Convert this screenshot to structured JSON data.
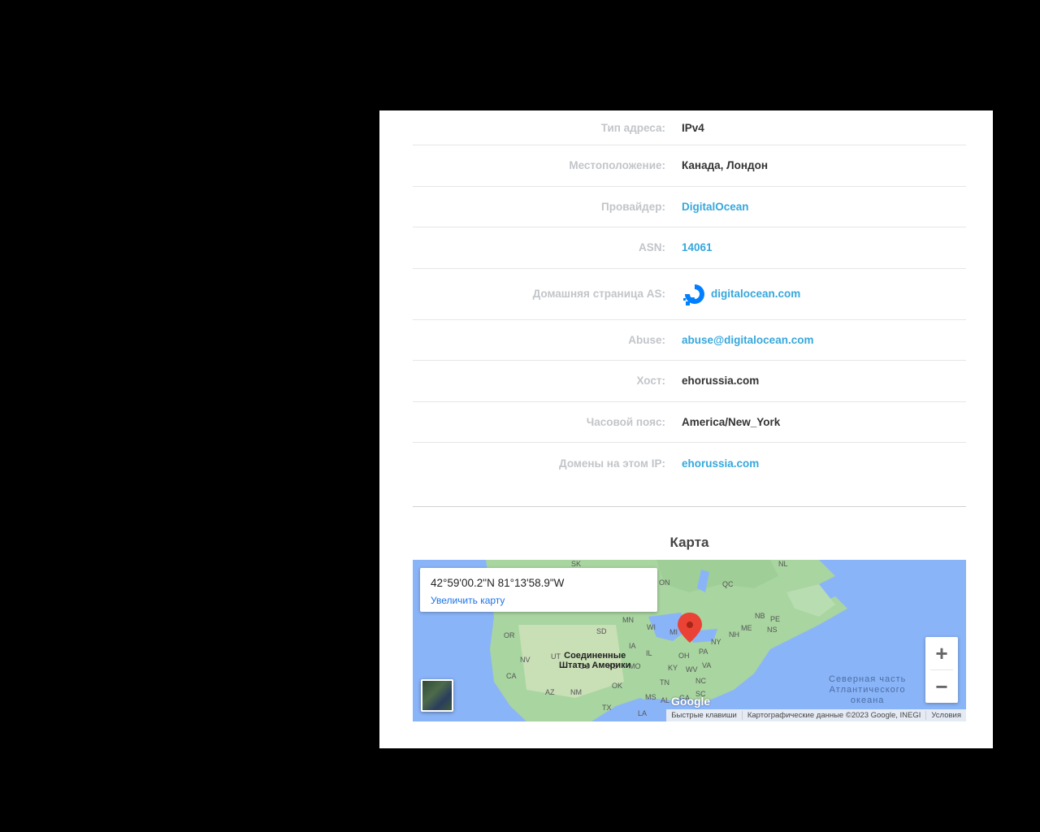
{
  "rows": [
    {
      "label": "Тип адреса:",
      "value": "IPv4",
      "link": false
    },
    {
      "label": "Местоположение:",
      "value": "Канада, Лондон",
      "link": false
    },
    {
      "label": "Провайдер:",
      "value": "DigitalOcean",
      "link": true
    },
    {
      "label": "ASN:",
      "value": "14061",
      "link": true
    },
    {
      "label": "Домашняя страница AS:",
      "value": "digitalocean.com",
      "link": true
    },
    {
      "label": "Abuse:",
      "value": "abuse@digitalocean.com",
      "link": true
    },
    {
      "label": "Хост:",
      "value": "ehorussia.com",
      "link": false
    },
    {
      "label": "Часовой пояс:",
      "value": "America/New_York",
      "link": false
    },
    {
      "label": "Домены на этом IP:",
      "value": "ehorussia.com",
      "link": true
    }
  ],
  "map": {
    "title": "Карта",
    "coords": "42°59'00.2\"N 81°13'58.9\"W",
    "enlarge_label": "Увеличить карту",
    "zoom_in": "+",
    "zoom_out": "−",
    "usa_label_line1": "Соединенные",
    "usa_label_line2": "Штаты Америки",
    "ocean_line1": "Северная часть",
    "ocean_line2": "Атлантического",
    "ocean_line3": "океана",
    "google": "Google",
    "attrib_shortcuts": "Быстрые клавиши",
    "attrib_data": "Картографические данные ©2023 Google, INEGI",
    "attrib_terms": "Условия",
    "state_labels": [
      "SK",
      "NL",
      "ON",
      "QC",
      "MN",
      "WI",
      "MI",
      "SD",
      "NB",
      "PE",
      "NS",
      "ME",
      "NH",
      "NY",
      "PA",
      "IA",
      "IL",
      "OH",
      "NV",
      "CA",
      "UT",
      "CO",
      "KS",
      "MO",
      "KY",
      "WV",
      "VA",
      "AZ",
      "NM",
      "OK",
      "TN",
      "NC",
      "MS",
      "AL",
      "GA",
      "SC",
      "TX",
      "LA",
      "OR"
    ],
    "colors": {
      "water": "#8ab4f8",
      "land": "#a8d5a0",
      "marker": "#ea4335",
      "accent": "#37a7dc"
    }
  }
}
